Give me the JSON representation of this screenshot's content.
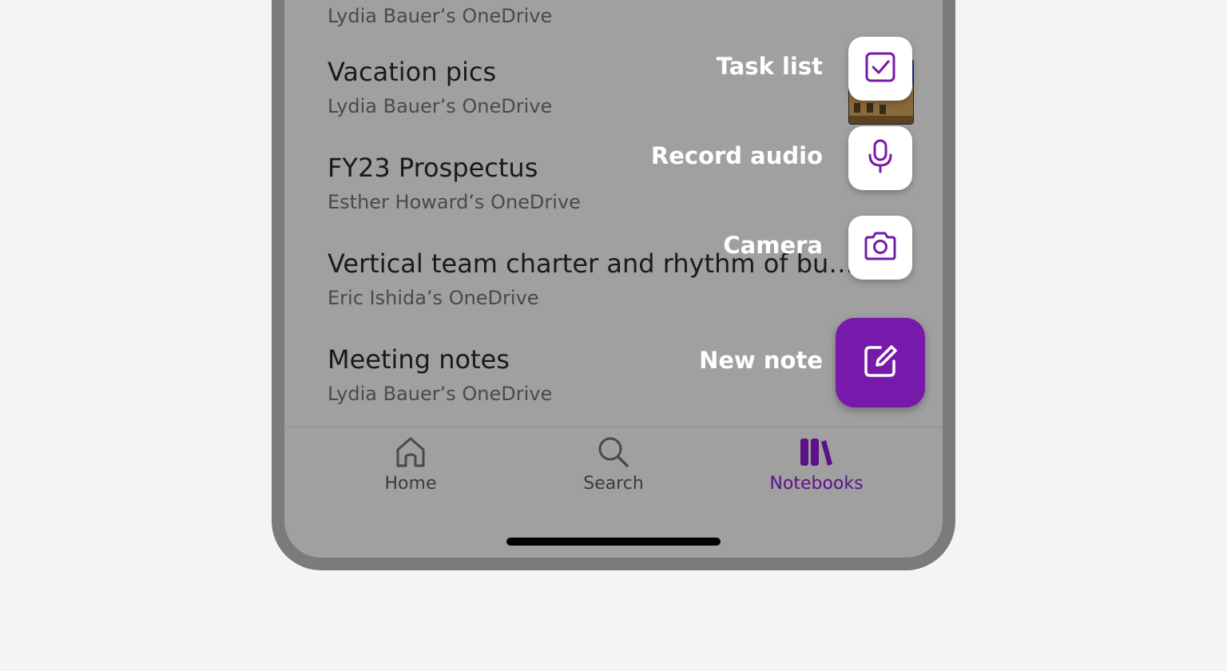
{
  "notebooks": {
    "top_partial_owner": "Lydia Bauer’s OneDrive",
    "items": [
      {
        "title": "Vacation pics",
        "owner": "Lydia Bauer’s OneDrive"
      },
      {
        "title": "FY23 Prospectus",
        "owner": "Esther Howard’s OneDrive"
      },
      {
        "title": "Vertical team charter and rhythm of business",
        "owner": "Eric Ishida’s OneDrive"
      },
      {
        "title": "Meeting notes",
        "owner": "Lydia Bauer’s OneDrive"
      }
    ]
  },
  "fab_menu": {
    "task_list": "Task list",
    "record_audio": "Record audio",
    "camera": "Camera",
    "new_note": "New note"
  },
  "tabs": [
    {
      "label": "Home",
      "icon": "home-icon",
      "active": false
    },
    {
      "label": "Search",
      "icon": "search-icon",
      "active": false
    },
    {
      "label": "Notebooks",
      "icon": "notebooks-icon",
      "active": true
    }
  ],
  "colors": {
    "accent": "#7719aa",
    "active_tab": "#5b1287",
    "overlay_bg": "#a0a0a0"
  }
}
